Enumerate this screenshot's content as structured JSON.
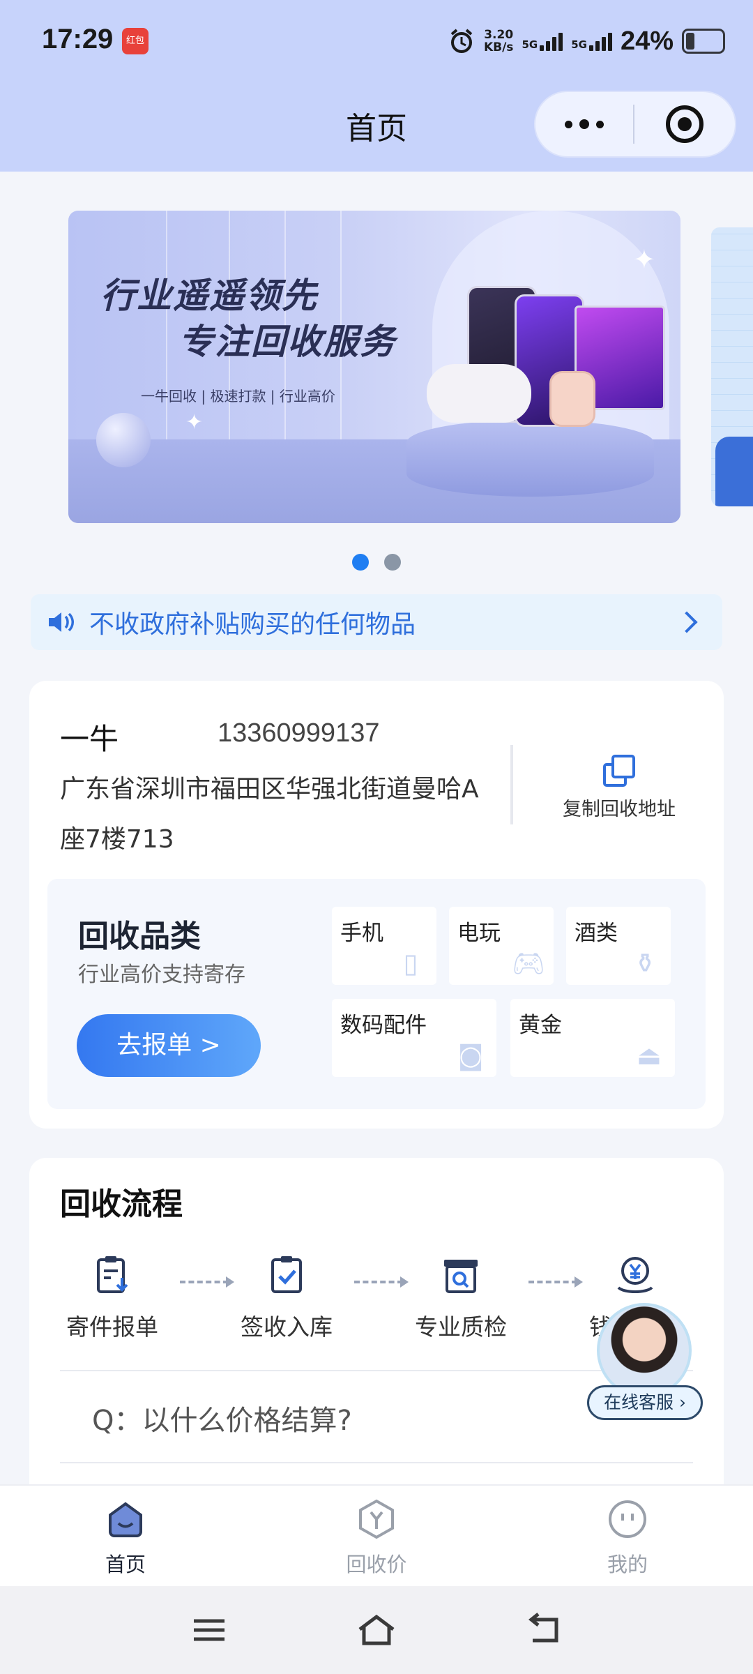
{
  "status_bar": {
    "time": "17:29",
    "app_badge": "红包",
    "net_speed_value": "3.20",
    "net_speed_unit": "KB/s",
    "sim1": "5G",
    "sim2": "5G",
    "battery_pct": "24%"
  },
  "header": {
    "title": "首页",
    "more_icon": "ellipsis-icon",
    "close_icon": "target-close-icon"
  },
  "banner": {
    "headline_1": "行业遥遥领先",
    "headline_2": "专注回收服务",
    "tagline": "一牛回收 | 极速打款  |  行业高价",
    "active_index": 0,
    "count": 2
  },
  "notice": {
    "text": "不收政府补贴购买的任何物品",
    "icon": "speaker-icon"
  },
  "address_card": {
    "name": "一牛",
    "phone": "13360999137",
    "address": "广东省深圳市福田区华强北街道曼哈A座7楼713",
    "copy_label": "复制回收地址"
  },
  "categories": {
    "title": "回收品类",
    "subtitle": "行业高价支持寄存",
    "button": "去报单 >",
    "items": [
      {
        "label": "手机",
        "icon": "phone-icon"
      },
      {
        "label": "电玩",
        "icon": "gamepad-icon"
      },
      {
        "label": "酒类",
        "icon": "bottle-icon"
      },
      {
        "label": "数码配件",
        "icon": "camera-icon"
      },
      {
        "label": "黄金",
        "icon": "gold-icon"
      }
    ]
  },
  "flow": {
    "title": "回收流程",
    "steps": [
      {
        "label": "寄件报单",
        "icon": "clipboard-download-icon"
      },
      {
        "label": "签收入库",
        "icon": "clipboard-check-icon"
      },
      {
        "label": "专业质检",
        "icon": "inspect-box-icon"
      },
      {
        "label": "钱包收款",
        "icon": "yuan-hand-icon"
      }
    ],
    "faq_1": "Q：以什么价格结算?"
  },
  "customer_service": {
    "label": "在线客服 ›"
  },
  "tabbar": {
    "items": [
      {
        "label": "首页",
        "icon": "home-icon",
        "active": true
      },
      {
        "label": "回收价",
        "icon": "yen-hexagon-icon",
        "active": false
      },
      {
        "label": "我的",
        "icon": "face-icon",
        "active": false
      }
    ]
  },
  "colors": {
    "accent": "#2f6fdc",
    "header_bg": "#c7d3fb",
    "page_bg": "#f3f5fa"
  }
}
